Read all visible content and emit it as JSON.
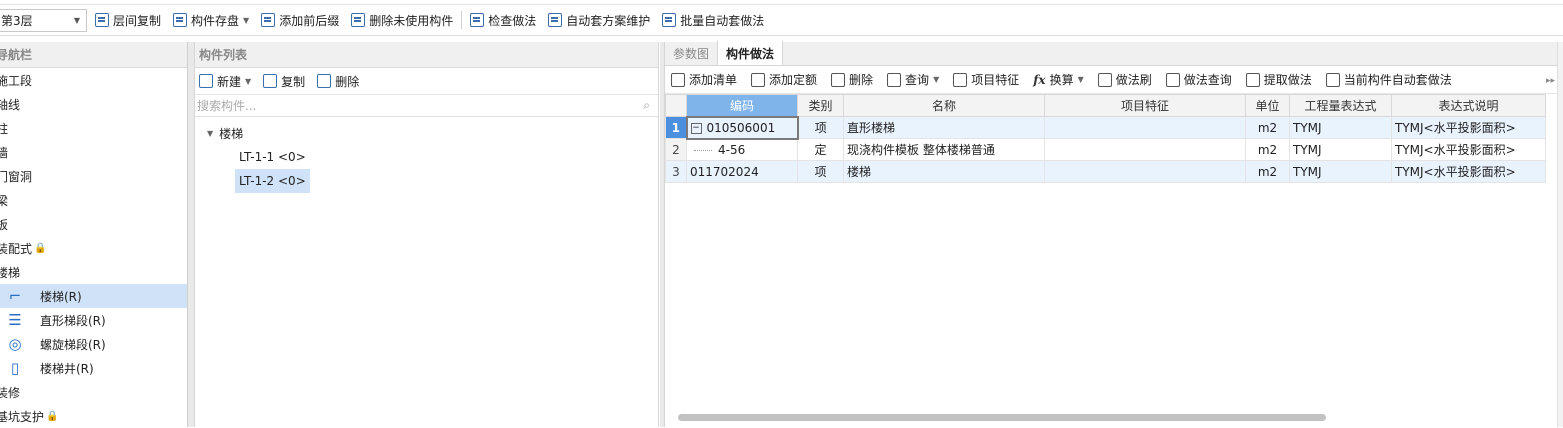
{
  "toolbar": {
    "floor": "第3层",
    "buttons": [
      "层间复制",
      "构件存盘",
      "添加前后缀",
      "删除未使用构件",
      "检查做法",
      "自动套方案维护",
      "批量自动套做法"
    ]
  },
  "nav": {
    "title": "导航栏",
    "items": [
      "施工段",
      "轴线",
      "柱",
      "墙",
      "门窗洞",
      "梁",
      "板",
      "装配式",
      "楼梯"
    ],
    "sub_items": [
      "楼梯(R)",
      "直形梯段(R)",
      "螺旋梯段(R)",
      "楼梯井(R)"
    ],
    "after": [
      "装修",
      "基坑支护"
    ]
  },
  "component_list": {
    "title": "构件列表",
    "tools": [
      "新建",
      "复制",
      "删除"
    ],
    "search_placeholder": "搜索构件...",
    "root": "楼梯",
    "leaves": [
      "LT-1-1 <0>",
      "LT-1-2 <0>"
    ]
  },
  "right": {
    "tabs": [
      "参数图",
      "构件做法"
    ],
    "tools": [
      "添加清单",
      "添加定额",
      "删除",
      "查询",
      "项目特征",
      "换算",
      "做法刷",
      "做法查询",
      "提取做法",
      "当前构件自动套做法"
    ],
    "columns": [
      "编码",
      "类别",
      "名称",
      "项目特征",
      "单位",
      "工程量表达式",
      "表达式说明"
    ],
    "rows": [
      {
        "n": "1",
        "code": "010506001",
        "type": "项",
        "name": "直形楼梯",
        "feature": "",
        "unit": "m2",
        "expr": "TYMJ",
        "desc": "TYMJ<水平投影面积>"
      },
      {
        "n": "2",
        "code": "4-56",
        "type": "定",
        "name": "现浇构件模板 整体楼梯普通",
        "feature": "",
        "unit": "m2",
        "expr": "TYMJ",
        "desc": "TYMJ<水平投影面积>"
      },
      {
        "n": "3",
        "code": "011702024",
        "type": "项",
        "name": "楼梯",
        "feature": "",
        "unit": "m2",
        "expr": "TYMJ",
        "desc": "TYMJ<水平投影面积>"
      }
    ]
  }
}
